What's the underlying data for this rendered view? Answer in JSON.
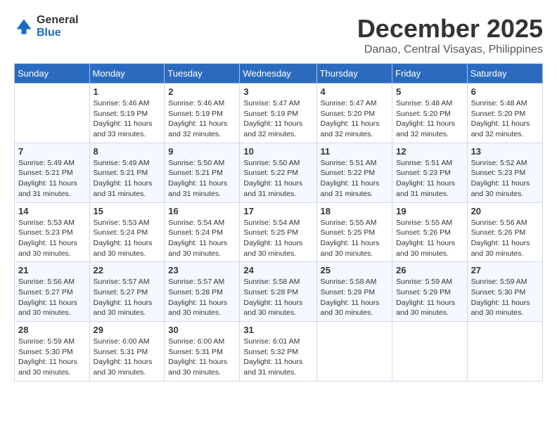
{
  "logo": {
    "general": "General",
    "blue": "Blue"
  },
  "title": "December 2025",
  "subtitle": "Danao, Central Visayas, Philippines",
  "headers": [
    "Sunday",
    "Monday",
    "Tuesday",
    "Wednesday",
    "Thursday",
    "Friday",
    "Saturday"
  ],
  "weeks": [
    [
      {
        "day": "",
        "sunrise": "",
        "sunset": "",
        "daylight": ""
      },
      {
        "day": "1",
        "sunrise": "Sunrise: 5:46 AM",
        "sunset": "Sunset: 5:19 PM",
        "daylight": "Daylight: 11 hours and 33 minutes."
      },
      {
        "day": "2",
        "sunrise": "Sunrise: 5:46 AM",
        "sunset": "Sunset: 5:19 PM",
        "daylight": "Daylight: 11 hours and 32 minutes."
      },
      {
        "day": "3",
        "sunrise": "Sunrise: 5:47 AM",
        "sunset": "Sunset: 5:19 PM",
        "daylight": "Daylight: 11 hours and 32 minutes."
      },
      {
        "day": "4",
        "sunrise": "Sunrise: 5:47 AM",
        "sunset": "Sunset: 5:20 PM",
        "daylight": "Daylight: 11 hours and 32 minutes."
      },
      {
        "day": "5",
        "sunrise": "Sunrise: 5:48 AM",
        "sunset": "Sunset: 5:20 PM",
        "daylight": "Daylight: 11 hours and 32 minutes."
      },
      {
        "day": "6",
        "sunrise": "Sunrise: 5:48 AM",
        "sunset": "Sunset: 5:20 PM",
        "daylight": "Daylight: 11 hours and 32 minutes."
      }
    ],
    [
      {
        "day": "7",
        "sunrise": "Sunrise: 5:49 AM",
        "sunset": "Sunset: 5:21 PM",
        "daylight": "Daylight: 11 hours and 31 minutes."
      },
      {
        "day": "8",
        "sunrise": "Sunrise: 5:49 AM",
        "sunset": "Sunset: 5:21 PM",
        "daylight": "Daylight: 11 hours and 31 minutes."
      },
      {
        "day": "9",
        "sunrise": "Sunrise: 5:50 AM",
        "sunset": "Sunset: 5:21 PM",
        "daylight": "Daylight: 11 hours and 31 minutes."
      },
      {
        "day": "10",
        "sunrise": "Sunrise: 5:50 AM",
        "sunset": "Sunset: 5:22 PM",
        "daylight": "Daylight: 11 hours and 31 minutes."
      },
      {
        "day": "11",
        "sunrise": "Sunrise: 5:51 AM",
        "sunset": "Sunset: 5:22 PM",
        "daylight": "Daylight: 11 hours and 31 minutes."
      },
      {
        "day": "12",
        "sunrise": "Sunrise: 5:51 AM",
        "sunset": "Sunset: 5:23 PM",
        "daylight": "Daylight: 11 hours and 31 minutes."
      },
      {
        "day": "13",
        "sunrise": "Sunrise: 5:52 AM",
        "sunset": "Sunset: 5:23 PM",
        "daylight": "Daylight: 11 hours and 30 minutes."
      }
    ],
    [
      {
        "day": "14",
        "sunrise": "Sunrise: 5:53 AM",
        "sunset": "Sunset: 5:23 PM",
        "daylight": "Daylight: 11 hours and 30 minutes."
      },
      {
        "day": "15",
        "sunrise": "Sunrise: 5:53 AM",
        "sunset": "Sunset: 5:24 PM",
        "daylight": "Daylight: 11 hours and 30 minutes."
      },
      {
        "day": "16",
        "sunrise": "Sunrise: 5:54 AM",
        "sunset": "Sunset: 5:24 PM",
        "daylight": "Daylight: 11 hours and 30 minutes."
      },
      {
        "day": "17",
        "sunrise": "Sunrise: 5:54 AM",
        "sunset": "Sunset: 5:25 PM",
        "daylight": "Daylight: 11 hours and 30 minutes."
      },
      {
        "day": "18",
        "sunrise": "Sunrise: 5:55 AM",
        "sunset": "Sunset: 5:25 PM",
        "daylight": "Daylight: 11 hours and 30 minutes."
      },
      {
        "day": "19",
        "sunrise": "Sunrise: 5:55 AM",
        "sunset": "Sunset: 5:26 PM",
        "daylight": "Daylight: 11 hours and 30 minutes."
      },
      {
        "day": "20",
        "sunrise": "Sunrise: 5:56 AM",
        "sunset": "Sunset: 5:26 PM",
        "daylight": "Daylight: 11 hours and 30 minutes."
      }
    ],
    [
      {
        "day": "21",
        "sunrise": "Sunrise: 5:56 AM",
        "sunset": "Sunset: 5:27 PM",
        "daylight": "Daylight: 11 hours and 30 minutes."
      },
      {
        "day": "22",
        "sunrise": "Sunrise: 5:57 AM",
        "sunset": "Sunset: 5:27 PM",
        "daylight": "Daylight: 11 hours and 30 minutes."
      },
      {
        "day": "23",
        "sunrise": "Sunrise: 5:57 AM",
        "sunset": "Sunset: 5:28 PM",
        "daylight": "Daylight: 11 hours and 30 minutes."
      },
      {
        "day": "24",
        "sunrise": "Sunrise: 5:58 AM",
        "sunset": "Sunset: 5:28 PM",
        "daylight": "Daylight: 11 hours and 30 minutes."
      },
      {
        "day": "25",
        "sunrise": "Sunrise: 5:58 AM",
        "sunset": "Sunset: 5:29 PM",
        "daylight": "Daylight: 11 hours and 30 minutes."
      },
      {
        "day": "26",
        "sunrise": "Sunrise: 5:59 AM",
        "sunset": "Sunset: 5:29 PM",
        "daylight": "Daylight: 11 hours and 30 minutes."
      },
      {
        "day": "27",
        "sunrise": "Sunrise: 5:59 AM",
        "sunset": "Sunset: 5:30 PM",
        "daylight": "Daylight: 11 hours and 30 minutes."
      }
    ],
    [
      {
        "day": "28",
        "sunrise": "Sunrise: 5:59 AM",
        "sunset": "Sunset: 5:30 PM",
        "daylight": "Daylight: 11 hours and 30 minutes."
      },
      {
        "day": "29",
        "sunrise": "Sunrise: 6:00 AM",
        "sunset": "Sunset: 5:31 PM",
        "daylight": "Daylight: 11 hours and 30 minutes."
      },
      {
        "day": "30",
        "sunrise": "Sunrise: 6:00 AM",
        "sunset": "Sunset: 5:31 PM",
        "daylight": "Daylight: 11 hours and 30 minutes."
      },
      {
        "day": "31",
        "sunrise": "Sunrise: 6:01 AM",
        "sunset": "Sunset: 5:32 PM",
        "daylight": "Daylight: 11 hours and 31 minutes."
      },
      {
        "day": "",
        "sunrise": "",
        "sunset": "",
        "daylight": ""
      },
      {
        "day": "",
        "sunrise": "",
        "sunset": "",
        "daylight": ""
      },
      {
        "day": "",
        "sunrise": "",
        "sunset": "",
        "daylight": ""
      }
    ]
  ]
}
